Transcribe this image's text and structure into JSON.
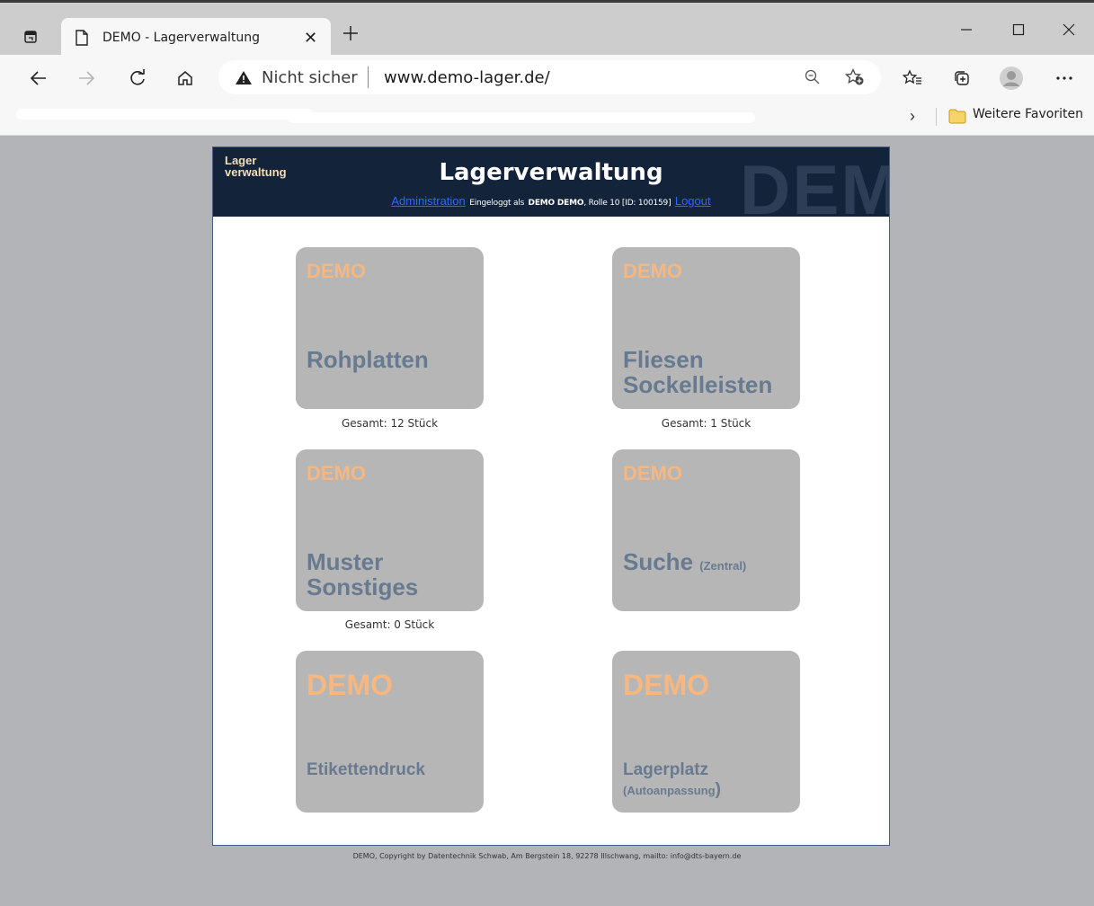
{
  "browser": {
    "tab_title": "DEMO - Lagerverwaltung",
    "not_secure_label": "Nicht sicher",
    "url": "www.demo-lager.de/",
    "favorites_folder": "Weitere Favoriten",
    "icons": [
      "tab-actions-icon",
      "page-icon",
      "close-icon",
      "plus-icon",
      "minimize-icon",
      "maximize-icon",
      "close-window-icon",
      "back-icon",
      "forward-icon",
      "refresh-icon",
      "home-icon",
      "warning-icon",
      "zoom-out-icon",
      "add-favorite-icon",
      "favorites-icon",
      "collections-icon",
      "profile-icon",
      "more-icon",
      "chevron-right-icon",
      "folder-icon"
    ]
  },
  "header": {
    "logo_line1": "Lager",
    "logo_line2": "verwaltung",
    "title": "Lagerverwaltung",
    "watermark": "DEMO",
    "admin_link": "Administration",
    "login_prefix": "Eingeloggt als",
    "user_name": "DEMO DEMO",
    "login_suffix": ", Rolle 10 [ID: 100159]",
    "logout_link": "Logout"
  },
  "tiles": [
    {
      "badge": "DEMO",
      "line1": "Rohplatten",
      "count": "Gesamt: 12 Stück"
    },
    {
      "badge": "DEMO",
      "line1": "Fliesen",
      "line2": "Sockelleisten",
      "count": "Gesamt: 1 Stück"
    },
    {
      "badge": "DEMO",
      "line1": "Muster",
      "line2": "Sonstiges",
      "count": "Gesamt: 0 Stück"
    },
    {
      "badge": "DEMO",
      "line1": "Suche",
      "note": "(Zentral)"
    },
    {
      "badge": "DEMO",
      "line1": "Etikettendruck"
    },
    {
      "badge": "DEMO",
      "line1": "Lagerplatz",
      "note": "(Autoanpassung",
      "note_close": ")"
    }
  ],
  "footer": "DEMO, Copyright by Datentechnik Schwab, Am Bergstein 18, 92278 Illschwang, mailto: info@dts-bayern.de",
  "colors": {
    "header_bg": "#13233a",
    "tile_bg": "#b6b6b6",
    "tile_text": "#687a8f",
    "badge": "#f7b77f",
    "link": "#2b68ff"
  }
}
